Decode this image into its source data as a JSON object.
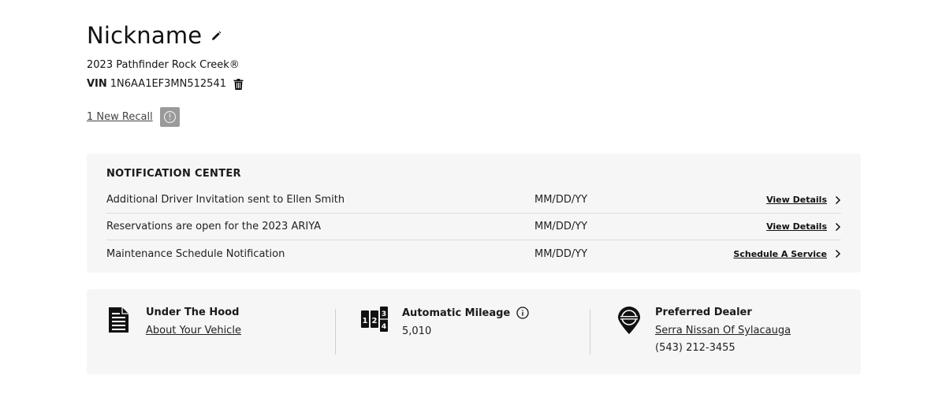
{
  "vehicle": {
    "nickname": "Nickname",
    "model": "2023 Pathfinder Rock Creek®",
    "vin_label": "VIN",
    "vin": "1N6AA1EF3MN512541",
    "recall_text": "1 New Recall"
  },
  "icons": {
    "edit": "pencil-icon",
    "delete": "trash-icon",
    "recall": "alert-circle-icon",
    "chevron": "chevron-right-icon",
    "document": "document-icon",
    "mileage": "odometer-icon",
    "info": "info-icon",
    "dealer": "location-pin-icon"
  },
  "notification_center": {
    "title": "NOTIFICATION CENTER",
    "items": [
      {
        "text": "Additional Driver Invitation sent to Ellen Smith",
        "date": "MM/DD/YY",
        "action": "View Details"
      },
      {
        "text": "Reservations are open for the 2023 ARIYA",
        "date": "MM/DD/YY",
        "action": "View Details"
      },
      {
        "text": "Maintenance Schedule Notification",
        "date": "MM/DD/YY",
        "action": "Schedule A Service"
      }
    ]
  },
  "cards": {
    "hood": {
      "title": "Under The Hood",
      "link": "About Your Vehicle"
    },
    "mileage": {
      "title": "Automatic Mileage",
      "value": "5,010",
      "odometer_digits": [
        "1",
        "2",
        "3",
        "4"
      ]
    },
    "dealer": {
      "title": "Preferred Dealer",
      "name": "Serra Nissan Of Sylacauga",
      "phone": "(543) 212-3455"
    }
  },
  "colors": {
    "panel_bg": "#f6f6f6",
    "recall_badge": "#9a9a9a",
    "text": "#111111"
  }
}
